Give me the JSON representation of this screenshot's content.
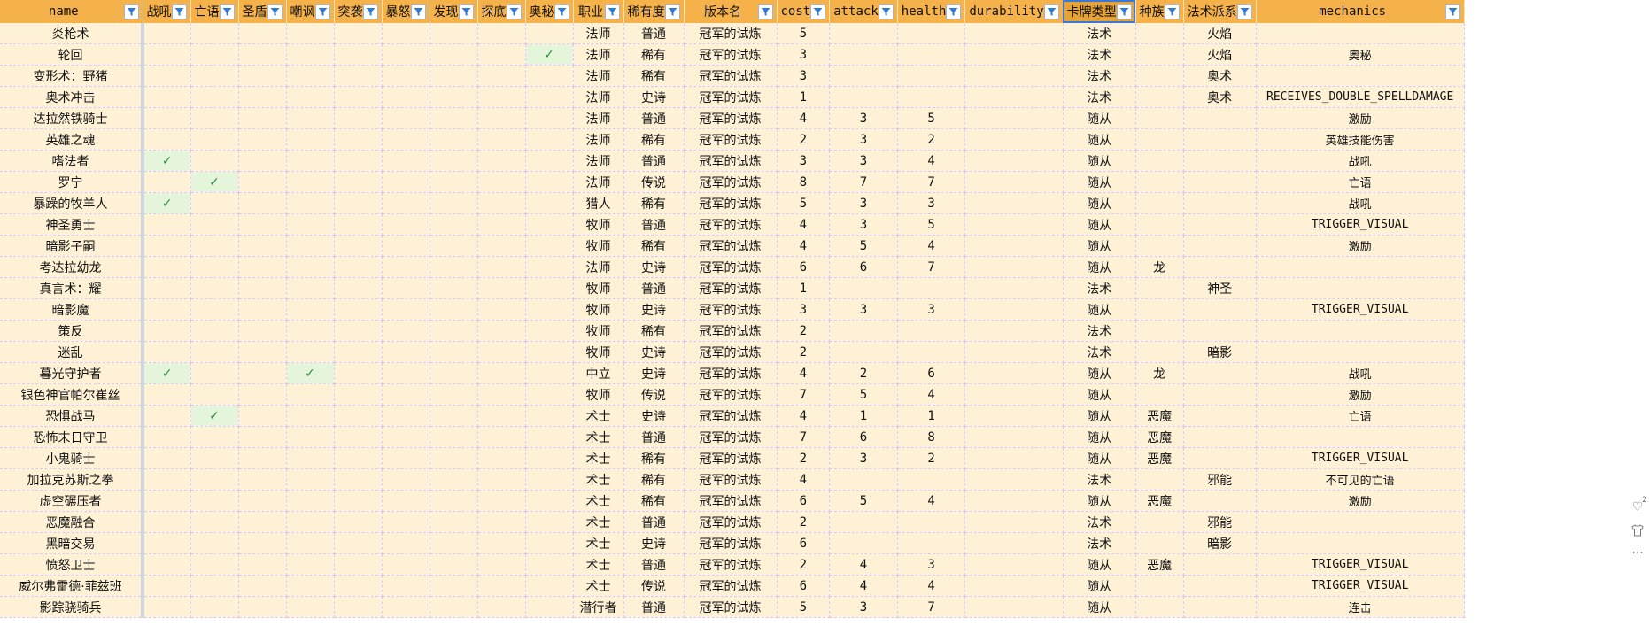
{
  "columns": [
    {
      "key": "name",
      "label": "name",
      "width": 161,
      "ascii": true
    },
    {
      "key": "battlecry",
      "label": "战吼",
      "width": 51
    },
    {
      "key": "deathrattle",
      "label": "亡语",
      "width": 51
    },
    {
      "key": "divine_shield",
      "label": "圣盾",
      "width": 51
    },
    {
      "key": "taunt",
      "label": "嘲讽",
      "width": 51
    },
    {
      "key": "rush",
      "label": "突袭",
      "width": 51
    },
    {
      "key": "enrage",
      "label": "暴怒",
      "width": 51
    },
    {
      "key": "discover",
      "label": "发现",
      "width": 51
    },
    {
      "key": "dredge",
      "label": "探底",
      "width": 51
    },
    {
      "key": "arcane",
      "label": "奥秘",
      "width": 51
    },
    {
      "key": "class",
      "label": "职业",
      "width": 57
    },
    {
      "key": "rarity",
      "label": "稀有度",
      "width": 68
    },
    {
      "key": "set",
      "label": "版本名",
      "width": 105
    },
    {
      "key": "cost",
      "label": "cost",
      "width": 51,
      "ascii": true
    },
    {
      "key": "attack",
      "label": "attack",
      "width": 65,
      "ascii": true
    },
    {
      "key": "health",
      "label": "health",
      "width": 67,
      "ascii": true
    },
    {
      "key": "durability",
      "label": "durability",
      "width": 93,
      "ascii": true
    },
    {
      "key": "card_type",
      "label": "卡牌类型",
      "width": 77,
      "highlighted": true
    },
    {
      "key": "race",
      "label": "种族",
      "width": 52
    },
    {
      "key": "school",
      "label": "法术派系",
      "width": 77
    },
    {
      "key": "mechanics",
      "label": "mechanics",
      "width": 235,
      "ascii": true
    }
  ],
  "rows": [
    {
      "name": "炎枪术",
      "class": "法师",
      "rarity": "普通",
      "set": "冠军的试炼",
      "cost": "5",
      "attack": "",
      "health": "",
      "durability": "",
      "card_type": "法术",
      "race": "",
      "school": "火焰",
      "mechanics": ""
    },
    {
      "name": "轮回",
      "arcane": "✓",
      "class": "法师",
      "rarity": "稀有",
      "set": "冠军的试炼",
      "cost": "3",
      "attack": "",
      "health": "",
      "durability": "",
      "card_type": "法术",
      "race": "",
      "school": "火焰",
      "mechanics": "奥秘"
    },
    {
      "name": "变形术：野猪",
      "class": "法师",
      "rarity": "稀有",
      "set": "冠军的试炼",
      "cost": "3",
      "attack": "",
      "health": "",
      "durability": "",
      "card_type": "法术",
      "race": "",
      "school": "奥术",
      "mechanics": ""
    },
    {
      "name": "奥术冲击",
      "class": "法师",
      "rarity": "史诗",
      "set": "冠军的试炼",
      "cost": "1",
      "attack": "",
      "health": "",
      "durability": "",
      "card_type": "法术",
      "race": "",
      "school": "奥术",
      "mechanics": "RECEIVES_DOUBLE_SPELLDAMAGE"
    },
    {
      "name": "达拉然铁骑士",
      "class": "法师",
      "rarity": "普通",
      "set": "冠军的试炼",
      "cost": "4",
      "attack": "3",
      "health": "5",
      "durability": "",
      "card_type": "随从",
      "race": "",
      "school": "",
      "mechanics": "激励"
    },
    {
      "name": "英雄之魂",
      "class": "法师",
      "rarity": "稀有",
      "set": "冠军的试炼",
      "cost": "2",
      "attack": "3",
      "health": "2",
      "durability": "",
      "card_type": "随从",
      "race": "",
      "school": "",
      "mechanics": "英雄技能伤害"
    },
    {
      "name": "嗜法者",
      "battlecry": "✓",
      "class": "法师",
      "rarity": "普通",
      "set": "冠军的试炼",
      "cost": "3",
      "attack": "3",
      "health": "4",
      "durability": "",
      "card_type": "随从",
      "race": "",
      "school": "",
      "mechanics": "战吼"
    },
    {
      "name": "罗宁",
      "deathrattle": "✓",
      "class": "法师",
      "rarity": "传说",
      "set": "冠军的试炼",
      "cost": "8",
      "attack": "7",
      "health": "7",
      "durability": "",
      "card_type": "随从",
      "race": "",
      "school": "",
      "mechanics": "亡语"
    },
    {
      "name": "暴躁的牧羊人",
      "battlecry": "✓",
      "class": "猎人",
      "rarity": "稀有",
      "set": "冠军的试炼",
      "cost": "5",
      "attack": "3",
      "health": "3",
      "durability": "",
      "card_type": "随从",
      "race": "",
      "school": "",
      "mechanics": "战吼"
    },
    {
      "name": "神圣勇士",
      "class": "牧师",
      "rarity": "普通",
      "set": "冠军的试炼",
      "cost": "4",
      "attack": "3",
      "health": "5",
      "durability": "",
      "card_type": "随从",
      "race": "",
      "school": "",
      "mechanics": "TRIGGER_VISUAL"
    },
    {
      "name": "暗影子嗣",
      "class": "牧师",
      "rarity": "稀有",
      "set": "冠军的试炼",
      "cost": "4",
      "attack": "5",
      "health": "4",
      "durability": "",
      "card_type": "随从",
      "race": "",
      "school": "",
      "mechanics": "激励"
    },
    {
      "name": "考达拉幼龙",
      "class": "法师",
      "rarity": "史诗",
      "set": "冠军的试炼",
      "cost": "6",
      "attack": "6",
      "health": "7",
      "durability": "",
      "card_type": "随从",
      "race": "龙",
      "school": "",
      "mechanics": ""
    },
    {
      "name": "真言术：耀",
      "class": "牧师",
      "rarity": "普通",
      "set": "冠军的试炼",
      "cost": "1",
      "attack": "",
      "health": "",
      "durability": "",
      "card_type": "法术",
      "race": "",
      "school": "神圣",
      "mechanics": ""
    },
    {
      "name": "暗影魔",
      "class": "牧师",
      "rarity": "史诗",
      "set": "冠军的试炼",
      "cost": "3",
      "attack": "3",
      "health": "3",
      "durability": "",
      "card_type": "随从",
      "race": "",
      "school": "",
      "mechanics": "TRIGGER_VISUAL"
    },
    {
      "name": "策反",
      "class": "牧师",
      "rarity": "稀有",
      "set": "冠军的试炼",
      "cost": "2",
      "attack": "",
      "health": "",
      "durability": "",
      "card_type": "法术",
      "race": "",
      "school": "",
      "mechanics": ""
    },
    {
      "name": "迷乱",
      "class": "牧师",
      "rarity": "史诗",
      "set": "冠军的试炼",
      "cost": "2",
      "attack": "",
      "health": "",
      "durability": "",
      "card_type": "法术",
      "race": "",
      "school": "暗影",
      "mechanics": ""
    },
    {
      "name": "暮光守护者",
      "battlecry": "✓",
      "taunt": "✓",
      "class": "中立",
      "rarity": "史诗",
      "set": "冠军的试炼",
      "cost": "4",
      "attack": "2",
      "health": "6",
      "durability": "",
      "card_type": "随从",
      "race": "龙",
      "school": "",
      "mechanics": "战吼"
    },
    {
      "name": "银色神官帕尔崔丝",
      "class": "牧师",
      "rarity": "传说",
      "set": "冠军的试炼",
      "cost": "7",
      "attack": "5",
      "health": "4",
      "durability": "",
      "card_type": "随从",
      "race": "",
      "school": "",
      "mechanics": "激励"
    },
    {
      "name": "恐惧战马",
      "deathrattle": "✓",
      "class": "术士",
      "rarity": "史诗",
      "set": "冠军的试炼",
      "cost": "4",
      "attack": "1",
      "health": "1",
      "durability": "",
      "card_type": "随从",
      "race": "恶魔",
      "school": "",
      "mechanics": "亡语"
    },
    {
      "name": "恐怖末日守卫",
      "class": "术士",
      "rarity": "普通",
      "set": "冠军的试炼",
      "cost": "7",
      "attack": "6",
      "health": "8",
      "durability": "",
      "card_type": "随从",
      "race": "恶魔",
      "school": "",
      "mechanics": ""
    },
    {
      "name": "小鬼骑士",
      "class": "术士",
      "rarity": "稀有",
      "set": "冠军的试炼",
      "cost": "2",
      "attack": "3",
      "health": "2",
      "durability": "",
      "card_type": "随从",
      "race": "恶魔",
      "school": "",
      "mechanics": "TRIGGER_VISUAL"
    },
    {
      "name": "加拉克苏斯之拳",
      "class": "术士",
      "rarity": "稀有",
      "set": "冠军的试炼",
      "cost": "4",
      "attack": "",
      "health": "",
      "durability": "",
      "card_type": "法术",
      "race": "",
      "school": "邪能",
      "mechanics": "不可见的亡语"
    },
    {
      "name": "虚空碾压者",
      "class": "术士",
      "rarity": "稀有",
      "set": "冠军的试炼",
      "cost": "6",
      "attack": "5",
      "health": "4",
      "durability": "",
      "card_type": "随从",
      "race": "恶魔",
      "school": "",
      "mechanics": "激励"
    },
    {
      "name": "恶魔融合",
      "class": "术士",
      "rarity": "普通",
      "set": "冠军的试炼",
      "cost": "2",
      "attack": "",
      "health": "",
      "durability": "",
      "card_type": "法术",
      "race": "",
      "school": "邪能",
      "mechanics": ""
    },
    {
      "name": "黑暗交易",
      "class": "术士",
      "rarity": "史诗",
      "set": "冠军的试炼",
      "cost": "6",
      "attack": "",
      "health": "",
      "durability": "",
      "card_type": "法术",
      "race": "",
      "school": "暗影",
      "mechanics": ""
    },
    {
      "name": "愤怒卫士",
      "class": "术士",
      "rarity": "普通",
      "set": "冠军的试炼",
      "cost": "2",
      "attack": "4",
      "health": "3",
      "durability": "",
      "card_type": "随从",
      "race": "恶魔",
      "school": "",
      "mechanics": "TRIGGER_VISUAL"
    },
    {
      "name": "威尔弗雷德·菲兹班",
      "class": "术士",
      "rarity": "传说",
      "set": "冠军的试炼",
      "cost": "6",
      "attack": "4",
      "health": "4",
      "durability": "",
      "card_type": "随从",
      "race": "",
      "school": "",
      "mechanics": "TRIGGER_VISUAL"
    },
    {
      "name": "影踪骁骑兵",
      "class": "潜行者",
      "rarity": "普通",
      "set": "冠军的试炼",
      "cost": "5",
      "attack": "3",
      "health": "7",
      "durability": "",
      "card_type": "随从",
      "race": "",
      "school": "",
      "mechanics": "连击"
    }
  ],
  "side_tools": {
    "like_count": "2"
  },
  "colors": {
    "header_bg": "#f5b24a",
    "cell_bg": "#fff1d5",
    "check_bg": "#e5f5dc",
    "grid": "#e0c3f0"
  },
  "icons": {
    "filter": "funnel-icon",
    "check": "check-icon",
    "like": "heart-icon",
    "shirt": "shirt-icon",
    "more": "more-dots-icon"
  }
}
